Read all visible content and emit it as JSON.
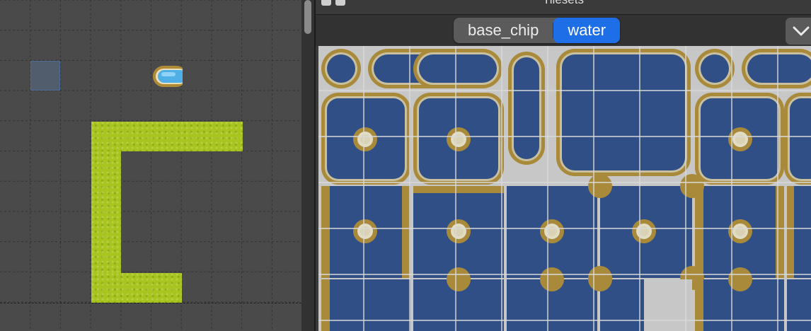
{
  "tilesets": {
    "title": "Tilesets",
    "tabs": [
      {
        "label": "base_chip",
        "active": false
      },
      {
        "label": "water",
        "active": true
      }
    ]
  },
  "icons": {
    "close": "close-icon",
    "float": "float-panel-icon",
    "menu": "chevron-down-icon"
  },
  "colors": {
    "map_background": "#4a4a4a",
    "grass": "#a8c41f",
    "selection": "#4d6e9c",
    "active_tab": "#1e6ee8",
    "water": "#2f4f86",
    "shore": "#a98a3a",
    "tileset_background": "#c7c7c7"
  }
}
